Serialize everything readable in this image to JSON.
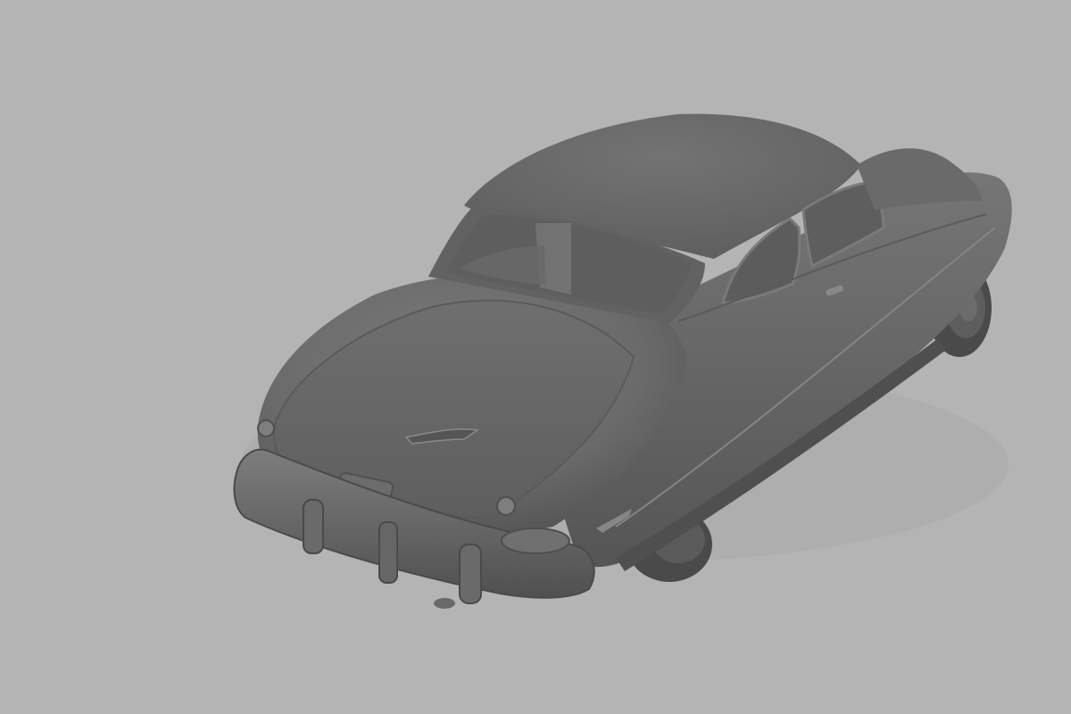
{
  "scene": {
    "subject": "car-model",
    "render_style": "clay-grey",
    "colors": {
      "background": "#b4b4b4",
      "body": "#6e6e6e",
      "body_dark": "#545454",
      "body_light": "#858585",
      "glass_interior": "#5f5f5f",
      "tire": "#4a4a4a"
    }
  }
}
